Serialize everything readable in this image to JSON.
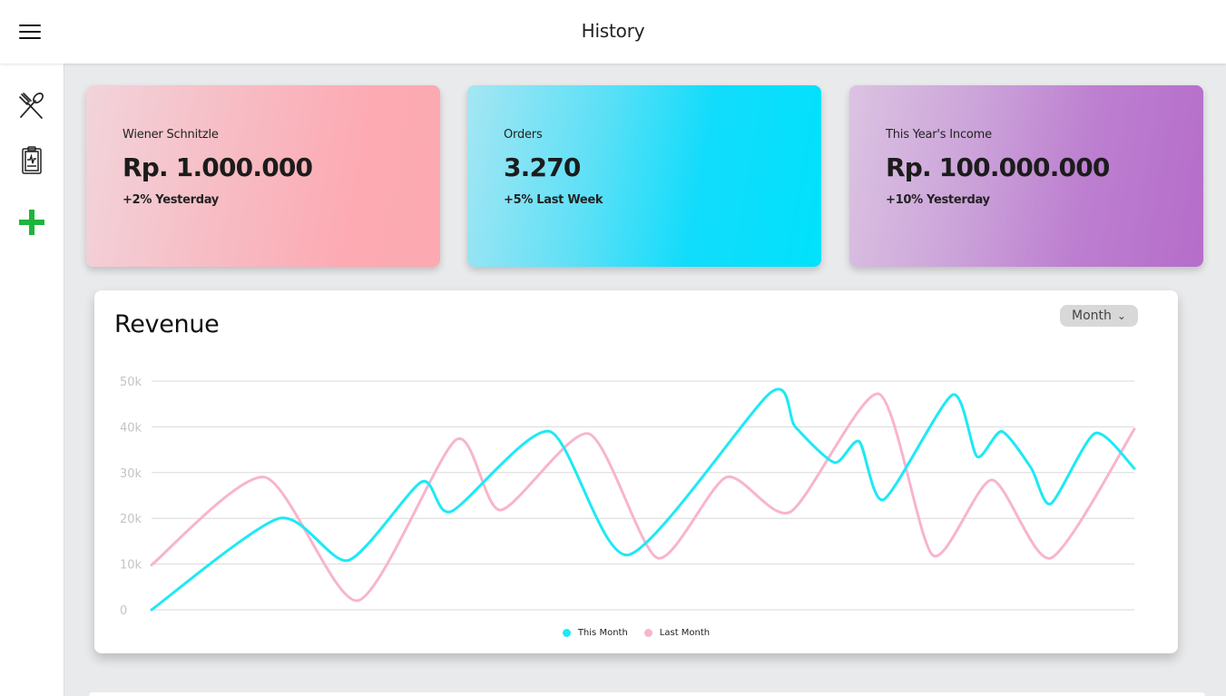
{
  "header": {
    "title": "History"
  },
  "sidebar": {
    "items": [
      {
        "icon": "fork-spoon-icon"
      },
      {
        "icon": "clipboard-icon"
      },
      {
        "icon": "plus-icon"
      }
    ]
  },
  "cards": [
    {
      "label": "Wiener Schnitzle",
      "value": "Rp. 1.000.000",
      "change": "+2% Yesterday"
    },
    {
      "label": "Orders",
      "value": "3.270",
      "change": "+5% Last Week"
    },
    {
      "label": "This Year's Income",
      "value": "Rp. 100.000.000",
      "change": "+10% Yesterday"
    }
  ],
  "revenue": {
    "title": "Revenue",
    "period": "Month"
  },
  "colors": {
    "this_month": "#1de9f5",
    "last_month": "#f8b4cf",
    "plus_icon": "#1db53a"
  },
  "chart_data": {
    "type": "line",
    "title": "Revenue",
    "y_ticks": [
      "0",
      "10k",
      "20k",
      "30k",
      "40k",
      "50k"
    ],
    "ylim": [
      0,
      50000
    ],
    "grid": true,
    "legend_position": "bottom",
    "series": [
      {
        "name": "This Month",
        "color": "#1de9f5",
        "points": [
          [
            0,
            0
          ],
          [
            1.3,
            20000
          ],
          [
            2.0,
            10800
          ],
          [
            2.75,
            28000
          ],
          [
            3.05,
            21500
          ],
          [
            4.05,
            39000
          ],
          [
            4.85,
            12000
          ],
          [
            6.3,
            47500
          ],
          [
            6.55,
            40000
          ],
          [
            6.95,
            32200
          ],
          [
            7.2,
            36800
          ],
          [
            7.45,
            24100
          ],
          [
            8.15,
            47000
          ],
          [
            8.4,
            33500
          ],
          [
            8.65,
            39000
          ],
          [
            8.95,
            31000
          ],
          [
            9.15,
            23200
          ],
          [
            9.6,
            38600
          ],
          [
            10.0,
            30900
          ]
        ]
      },
      {
        "name": "Last Month",
        "color": "#f8b4cf",
        "points": [
          [
            0,
            9800
          ],
          [
            1.15,
            29000
          ],
          [
            2.1,
            2000
          ],
          [
            3.1,
            37200
          ],
          [
            3.55,
            21800
          ],
          [
            4.45,
            38500
          ],
          [
            5.15,
            11300
          ],
          [
            5.85,
            29000
          ],
          [
            6.5,
            21400
          ],
          [
            7.4,
            47200
          ],
          [
            7.95,
            11900
          ],
          [
            8.55,
            28400
          ],
          [
            9.15,
            11300
          ],
          [
            10.0,
            39500
          ]
        ]
      }
    ]
  }
}
